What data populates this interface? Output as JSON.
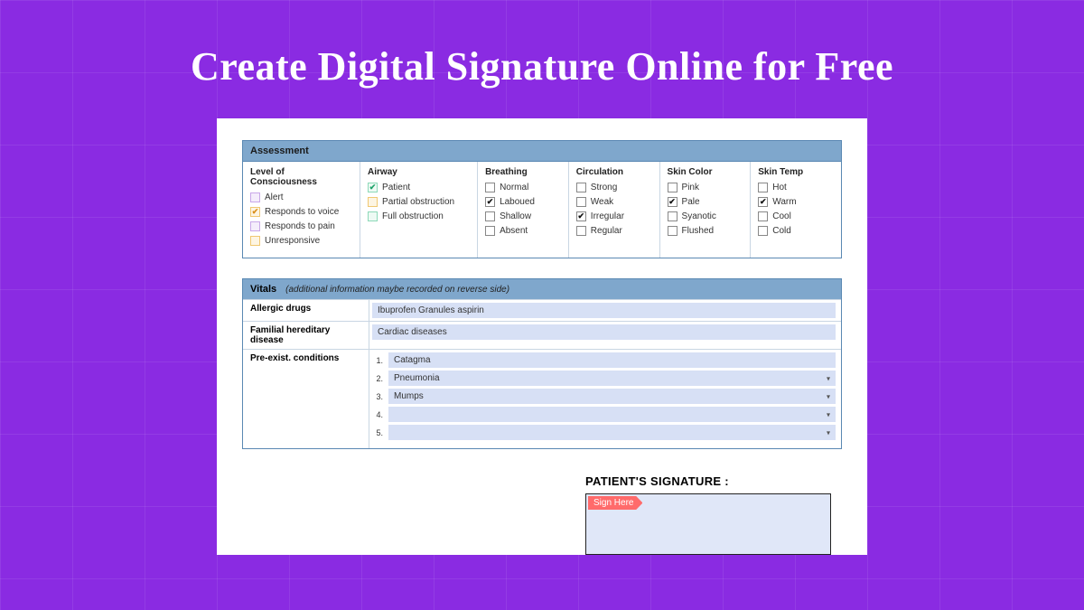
{
  "hero": {
    "title": "Create Digital Signature Online for Free"
  },
  "assessment": {
    "header": "Assessment",
    "cols": [
      {
        "title": "Level of Consciousness",
        "items": [
          {
            "label": "Alert",
            "style": "purple",
            "checked": false
          },
          {
            "label": "Responds to voice",
            "style": "orange",
            "checked": true
          },
          {
            "label": "Responds to pain",
            "style": "purple",
            "checked": false
          },
          {
            "label": "Unresponsive",
            "style": "orange",
            "checked": false
          }
        ]
      },
      {
        "title": "Airway",
        "items": [
          {
            "label": "Patient",
            "style": "green",
            "checked": true
          },
          {
            "label": "Partial obstruction",
            "style": "orange",
            "checked": false
          },
          {
            "label": "Full obstruction",
            "style": "green",
            "checked": false
          }
        ]
      },
      {
        "title": "Breathing",
        "items": [
          {
            "label": "Normal",
            "style": "plain",
            "checked": false
          },
          {
            "label": "Laboued",
            "style": "plain",
            "checked": true
          },
          {
            "label": "Shallow",
            "style": "plain",
            "checked": false
          },
          {
            "label": "Absent",
            "style": "plain",
            "checked": false
          }
        ]
      },
      {
        "title": "Circulation",
        "items": [
          {
            "label": "Strong",
            "style": "plain",
            "checked": false
          },
          {
            "label": "Weak",
            "style": "plain",
            "checked": false
          },
          {
            "label": "Irregular",
            "style": "plain",
            "checked": true
          },
          {
            "label": "Regular",
            "style": "plain",
            "checked": false
          }
        ]
      },
      {
        "title": "Skin Color",
        "items": [
          {
            "label": "Pink",
            "style": "plain",
            "checked": false
          },
          {
            "label": "Pale",
            "style": "plain",
            "checked": true
          },
          {
            "label": "Syanotic",
            "style": "plain",
            "checked": false
          },
          {
            "label": "Flushed",
            "style": "plain",
            "checked": false
          }
        ]
      },
      {
        "title": "Skin Temp",
        "items": [
          {
            "label": "Hot",
            "style": "plain",
            "checked": false
          },
          {
            "label": "Warm",
            "style": "plain",
            "checked": true
          },
          {
            "label": "Cool",
            "style": "plain",
            "checked": false
          },
          {
            "label": "Cold",
            "style": "plain",
            "checked": false
          }
        ]
      }
    ]
  },
  "vitals": {
    "header": "Vitals",
    "note": "(additional information maybe recorded on reverse side)",
    "allergic_label": "Allergic drugs",
    "allergic_value": "Ibuprofen Granules  aspirin",
    "familial_label": "Familial hereditary disease",
    "familial_value": "Cardiac diseases",
    "preexist_label": "Pre-exist. conditions",
    "conditions": [
      {
        "num": "1.",
        "value": "Catagma",
        "dropdown": false
      },
      {
        "num": "2.",
        "value": "Pneumonia",
        "dropdown": true
      },
      {
        "num": "3.",
        "value": "Mumps",
        "dropdown": true
      },
      {
        "num": "4.",
        "value": "",
        "dropdown": true
      },
      {
        "num": "5.",
        "value": "",
        "dropdown": true
      }
    ]
  },
  "signature": {
    "title": "PATIENT'S SIGNATURE :",
    "tag": "Sign Here"
  }
}
